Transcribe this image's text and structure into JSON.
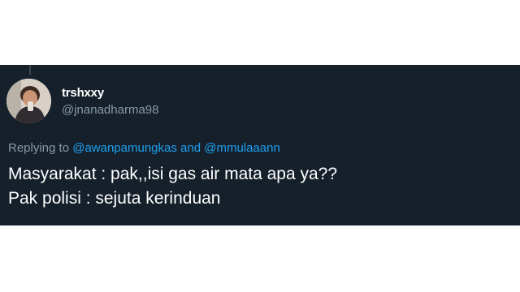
{
  "tweet": {
    "author": {
      "display_name": "trshxxy",
      "handle": "@jnanadharma98",
      "avatar_icon": "user-photo"
    },
    "reply": {
      "prefix": "Replying to",
      "mention_1": "@awanpamungkas",
      "connector": "and",
      "mention_2": "@mmulaaann"
    },
    "lines": [
      "Masyarakat : pak,,isi gas air mata apa ya??",
      "Pak polisi : sejuta kerinduan"
    ]
  },
  "colors": {
    "background": "#15202b",
    "text": "#ffffff",
    "secondary_text": "#8899a6",
    "accent": "#1da1f2"
  }
}
